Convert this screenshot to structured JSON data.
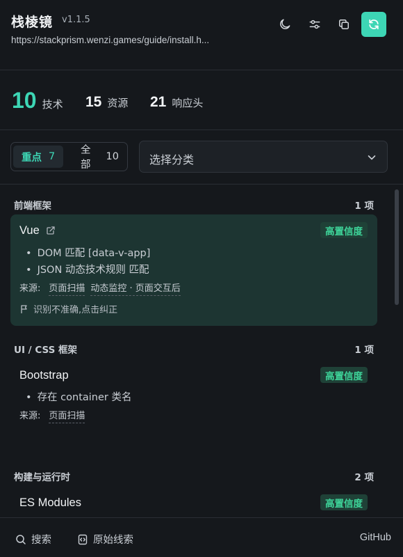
{
  "header": {
    "app_name": "栈棱镜",
    "version": "v1.1.5",
    "url": "https://stackprism.wenzi.games/guide/install.h...",
    "icons": [
      "moon-icon",
      "sliders-icon",
      "copy-icon",
      "refresh-icon"
    ],
    "accent_color": "#3dd6b5"
  },
  "stats": [
    {
      "value": "10",
      "label": "技术"
    },
    {
      "value": "15",
      "label": "资源"
    },
    {
      "value": "21",
      "label": "响应头"
    }
  ],
  "filters": {
    "key_label": "重点",
    "key_count": "7",
    "all_label": "全部",
    "all_count": "10",
    "category_select": "选择分类"
  },
  "sections": [
    {
      "title": "前端框架",
      "count": "1 项",
      "items": [
        {
          "name": "Vue",
          "badge": "高置信度",
          "evidence": [
            "DOM 匹配 [data-v-app]",
            "JSON 动态技术规则 匹配"
          ],
          "source_label": "来源:",
          "sources": [
            "页面扫描",
            "动态监控 · 页面交互后"
          ],
          "feedback": "识别不准确,点击纠正"
        }
      ]
    },
    {
      "title": "UI / CSS 框架",
      "count": "1 项",
      "items": [
        {
          "name": "Bootstrap",
          "badge": "高置信度",
          "evidence": [
            "存在 container 类名"
          ],
          "source_label": "来源:",
          "sources": [
            "页面扫描"
          ]
        }
      ]
    },
    {
      "title": "构建与运行时",
      "count": "2 项",
      "items": [
        {
          "name": "ES Modules",
          "badge": "高置信度"
        }
      ]
    }
  ],
  "footer": {
    "search": "搜索",
    "raw_clues": "原始线索",
    "github": "GitHub"
  }
}
